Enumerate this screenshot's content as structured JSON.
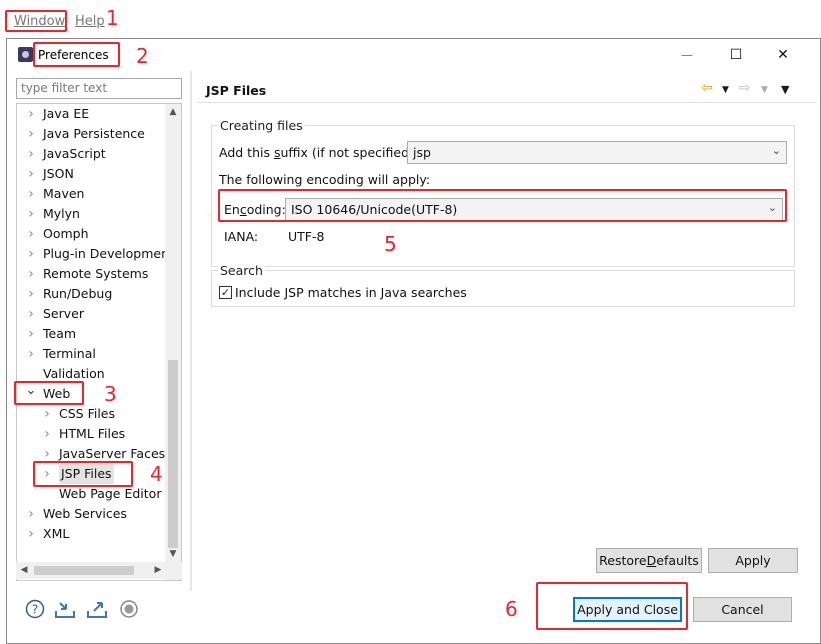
{
  "menubar": {
    "window": "Window",
    "help": "Help"
  },
  "annotations": [
    "1",
    "2",
    "3",
    "4",
    "5",
    "6"
  ],
  "dialog": {
    "title": "Preferences",
    "controls": {
      "minimize": "—",
      "maximize": "☐",
      "close": "✕"
    }
  },
  "sidebar": {
    "filter_placeholder": "type filter text",
    "items": [
      {
        "label": "Java EE",
        "level": 0,
        "expanded": false
      },
      {
        "label": "Java Persistence",
        "level": 0,
        "expanded": false
      },
      {
        "label": "JavaScript",
        "level": 0,
        "expanded": false
      },
      {
        "label": "JSON",
        "level": 0,
        "expanded": false
      },
      {
        "label": "Maven",
        "level": 0,
        "expanded": false
      },
      {
        "label": "Mylyn",
        "level": 0,
        "expanded": false
      },
      {
        "label": "Oomph",
        "level": 0,
        "expanded": false
      },
      {
        "label": "Plug-in Development",
        "level": 0,
        "expanded": false
      },
      {
        "label": "Remote Systems",
        "level": 0,
        "expanded": false
      },
      {
        "label": "Run/Debug",
        "level": 0,
        "expanded": false
      },
      {
        "label": "Server",
        "level": 0,
        "expanded": false
      },
      {
        "label": "Team",
        "level": 0,
        "expanded": false
      },
      {
        "label": "Terminal",
        "level": 0,
        "expanded": false
      },
      {
        "label": "Validation",
        "level": 0,
        "leaf": true
      },
      {
        "label": "Web",
        "level": 0,
        "expanded": true
      },
      {
        "label": "CSS Files",
        "level": 1,
        "expanded": false
      },
      {
        "label": "HTML Files",
        "level": 1,
        "expanded": false
      },
      {
        "label": "JavaServer Faces To",
        "level": 1,
        "expanded": false
      },
      {
        "label": "JSP Files",
        "level": 1,
        "expanded": false,
        "selected": true
      },
      {
        "label": "Web Page Editor",
        "level": 1,
        "leaf": true
      },
      {
        "label": "Web Services",
        "level": 0,
        "expanded": false
      },
      {
        "label": "XML",
        "level": 0,
        "expanded": false
      }
    ]
  },
  "page": {
    "title": "JSP Files",
    "creating_files": {
      "group_label": "Creating files",
      "suffix_label_pre": "Add this ",
      "suffix_label_ul": "s",
      "suffix_label_post": "uffix (if not specified):",
      "suffix_value": "jsp",
      "encoding_note": "The following encoding will apply:",
      "encoding_label_pre": "En",
      "encoding_label_ul": "c",
      "encoding_label_post": "oding:",
      "encoding_value": "ISO 10646/Unicode(UTF-8)",
      "iana_label": "IANA:",
      "iana_value": "UTF-8"
    },
    "search": {
      "group_label": "Search",
      "include_label": "Include JSP matches in Java searches",
      "include_checked": true
    }
  },
  "buttons": {
    "restore_pre": "Restore ",
    "restore_ul": "D",
    "restore_post": "efaults",
    "apply": "Apply",
    "apply_close": "Apply and Close",
    "cancel": "Cancel"
  },
  "icons": {
    "help": "help-icon",
    "import": "import-icon",
    "export": "export-icon",
    "record": "record-icon",
    "back": "back-arrow-icon",
    "forward": "forward-arrow-icon",
    "menu": "view-menu-icon"
  }
}
